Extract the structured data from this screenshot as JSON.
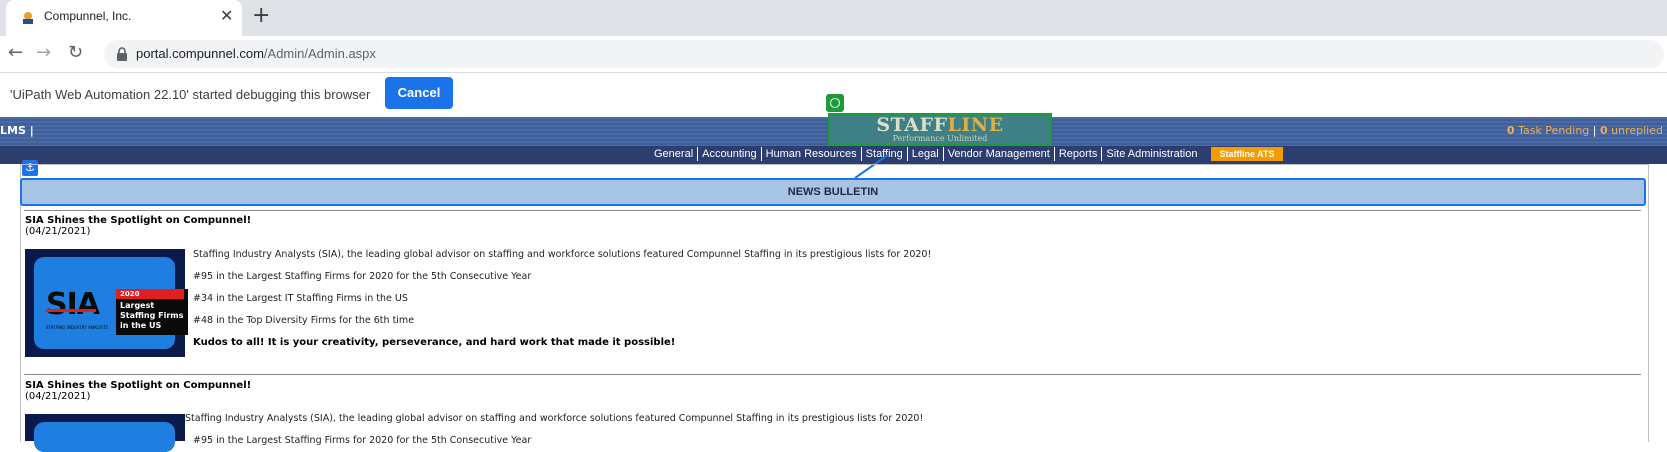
{
  "browser": {
    "tab_title": "Compunnel, Inc.",
    "tab_close": "✕",
    "new_tab": "+",
    "back": "←",
    "forward": "→",
    "reload": "↻",
    "url_host": "portal.compunnel.com",
    "url_path": "/Admin/Admin.aspx"
  },
  "infobar": {
    "message": "'UiPath Web Automation 22.10' started debugging this browser",
    "cancel_label": "Cancel"
  },
  "header": {
    "left_label": "LMS  |",
    "logo_main_a": "STAFF",
    "logo_main_b": "LINE",
    "logo_sub": "Performance Unlimited",
    "task_count": "0",
    "task_label": " Task Pending",
    "unreplied_sep": "  |",
    "unreplied_count": "0",
    "unreplied_label": " unreplied"
  },
  "nav": {
    "items": [
      "General",
      "Accounting",
      "Human Resources",
      "Staffing",
      "Legal",
      "Vendor Management",
      "Reports",
      "Site Administration"
    ],
    "ats_label": "Staffline ATS"
  },
  "bulletin": {
    "title": "NEWS BULLETIN"
  },
  "articles": [
    {
      "title": "SIA Shines the Spotlight on Compunnel!",
      "date": "(04/21/2021)",
      "image": {
        "brand": "SIA",
        "sub": "STAFFING INDUSTRY ANALYSTS",
        "year": "2020",
        "caption": "Largest Staffing Firms in the US"
      },
      "lines": [
        "Staffing Industry Analysts (SIA), the leading global advisor on staffing and workforce solutions featured Compunnel Staffing in its prestigious lists for 2020!",
        "#95 in the Largest Staffing Firms for 2020 for the 5th Consecutive Year",
        "#34 in the Largest IT Staffing Firms in the US",
        "#48 in the Top Diversity Firms for the 6th time"
      ],
      "kudos": "Kudos to all! It is your creativity, perseverance, and hard work that made it possible!"
    },
    {
      "title": "SIA Shines the Spotlight on Compunnel!",
      "date": "(04/21/2021)",
      "lines": [
        "Staffing Industry Analysts (SIA), the leading global advisor on staffing and workforce solutions featured Compunnel Staffing in its prestigious lists for 2020!",
        "#95 in the Largest Staffing Firms for 2020 for the 5th Consecutive Year"
      ]
    }
  ]
}
